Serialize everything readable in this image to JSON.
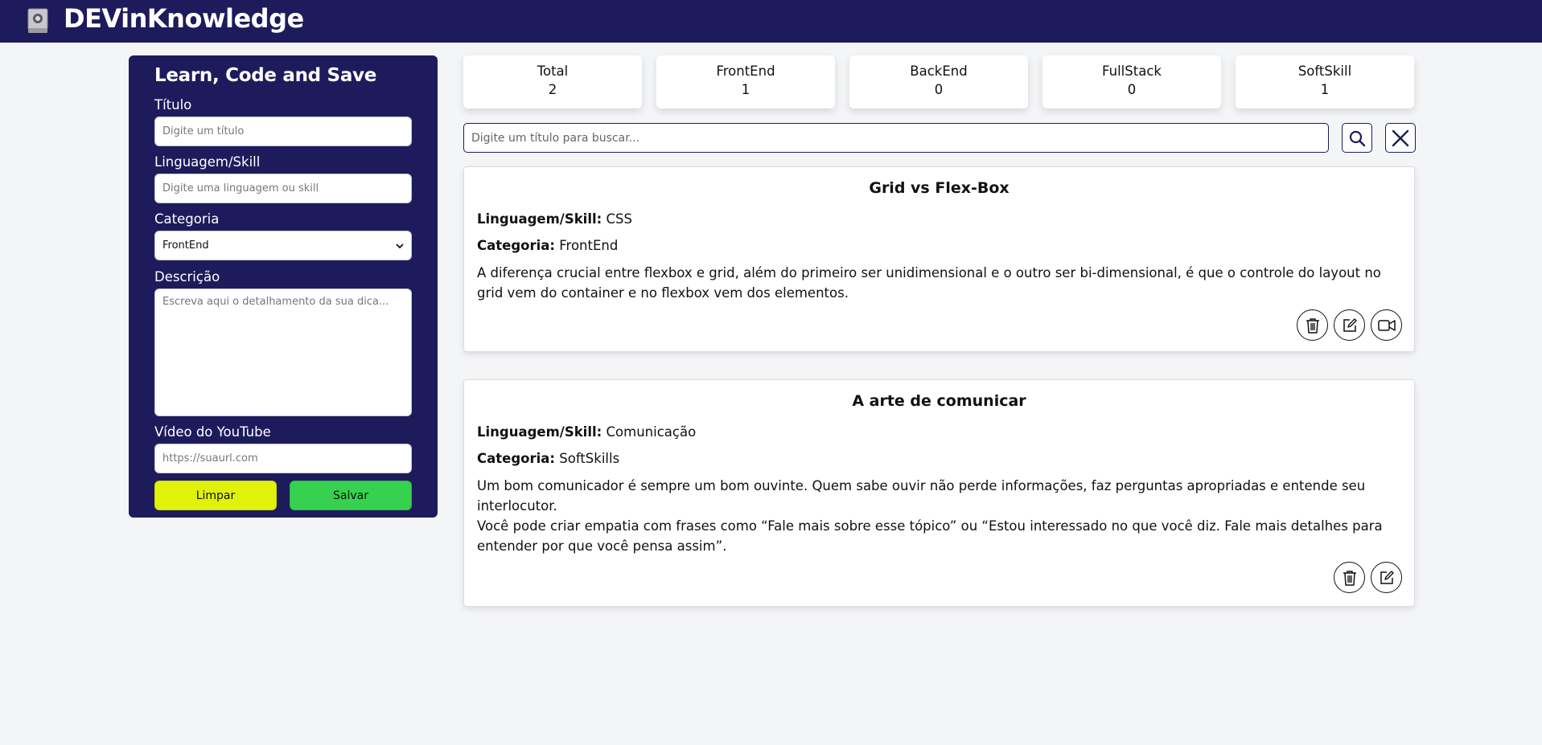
{
  "header": {
    "title": "DEVinKnowledge",
    "logo_icon": "book-icon"
  },
  "form": {
    "heading": "Learn, Code and Save",
    "title_label": "Título",
    "title_placeholder": "Digite um título",
    "skill_label": "Linguagem/Skill",
    "skill_placeholder": "Digite uma linguagem ou skill",
    "category_label": "Categoria",
    "category_selected": "FrontEnd",
    "description_label": "Descrição",
    "description_placeholder": "Escreva aqui o detalhamento da sua dica...",
    "video_label": "Vídeo do YouTube",
    "video_placeholder": "https://suaurl.com",
    "clear_label": "Limpar",
    "save_label": "Salvar"
  },
  "stats": [
    {
      "label": "Total",
      "value": "2"
    },
    {
      "label": "FrontEnd",
      "value": "1"
    },
    {
      "label": "BackEnd",
      "value": "0"
    },
    {
      "label": "FullStack",
      "value": "0"
    },
    {
      "label": "SoftSkill",
      "value": "1"
    }
  ],
  "search": {
    "placeholder": "Digite um título para buscar..."
  },
  "cards": [
    {
      "title": "Grid vs Flex-Box",
      "skill_label": "Linguagem/Skill:",
      "skill": "CSS",
      "category_label": "Categoria:",
      "category": "FrontEnd",
      "description": "A diferença crucial entre flexbox e grid, além do primeiro ser unidimensional e o outro ser bi-dimensional, é que o controle do layout no grid vem do container e no flexbox vem dos elementos."
    },
    {
      "title": "A arte de comunicar",
      "skill_label": "Linguagem/Skill:",
      "skill": "Comunicação",
      "category_label": "Categoria:",
      "category": "SoftSkills",
      "description_1": "Um bom comunicador é sempre um bom ouvinte. Quem sabe ouvir não perde informações, faz perguntas apropriadas e entende seu interlocutor.",
      "description_2": "Você pode criar empatia com frases como “Fale mais sobre esse tópico” ou “Estou interessado no que você diz. Fale mais detalhes para entender por que você pensa assim”."
    }
  ],
  "colors": {
    "primary": "#1e1b5c",
    "clear_button": "#e1f20a",
    "save_button": "#36d24f",
    "background": "#f4f5f7"
  }
}
